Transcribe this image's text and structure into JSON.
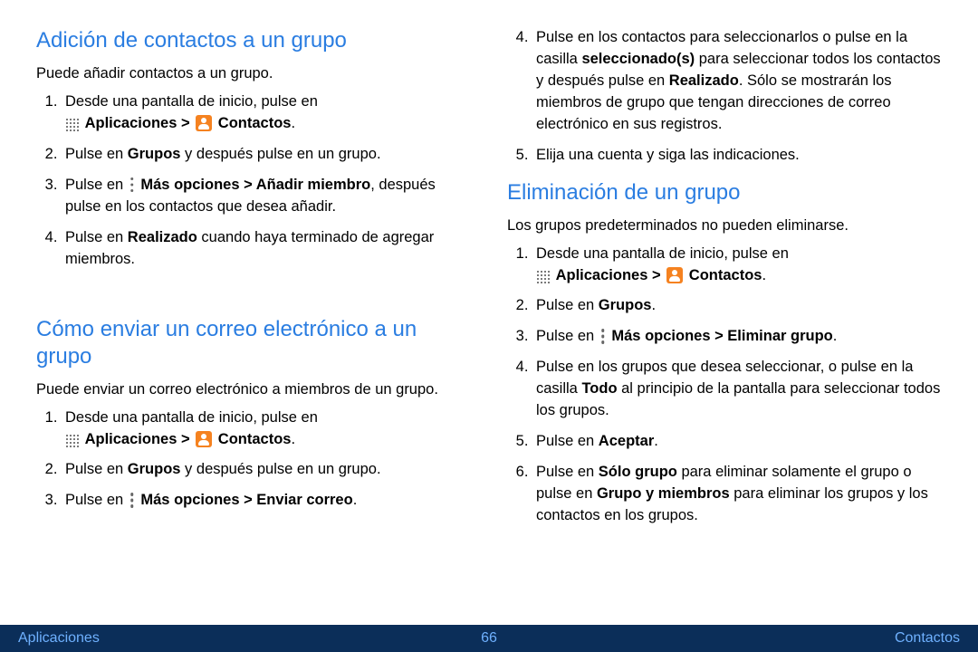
{
  "left": {
    "s1": {
      "title": "Adición de contactos a un grupo",
      "intro": "Puede añadir contactos a un grupo.",
      "li1": "Desde una pantalla de inicio, pulse en ",
      "apps": "Aplicaciones",
      "gt": " > ",
      "contacts": "Contactos",
      "period": ".",
      "li2a": "Pulse en ",
      "li2b": "Grupos",
      "li2c": " y después pulse en un grupo.",
      "li3a": "Pulse en ",
      "li3b": "Más opciones > Añadir miembro",
      "li3c": ", ",
      "li3d": "después pulse en los contactos que desea añadir.",
      "li4a": "Pulse en ",
      "li4b": "Realizado",
      "li4c": " cuando haya terminado de agregar miembros."
    },
    "s2": {
      "title": "Cómo enviar un correo electrónico a un grupo",
      "intro": "Puede enviar un correo electrónico a miembros de un grupo.",
      "li1": "Desde una pantalla de inicio, pulse en ",
      "apps": "Aplicaciones",
      "gt": " > ",
      "contacts": "Contactos",
      "period": ".",
      "li2a": "Pulse en ",
      "li2b": "Grupos",
      "li2c": " y después pulse en un grupo.",
      "li3a": "Pulse en ",
      "li3b": "Más opciones > Enviar correo",
      "li3c": "."
    }
  },
  "right": {
    "li4a": "Pulse en los contactos para seleccionarlos o pulse en la casilla ",
    "li4b": "seleccionado(s)",
    "li4c": " para seleccionar todos los contactos y después pulse en ",
    "li4d": "Realizado",
    "li4e": ". Sólo se mostrarán los miembros de grupo que tengan direcciones de correo electrónico en sus registros.",
    "li5": "Elija una cuenta y siga las indicaciones.",
    "s3": {
      "title": "Eliminación de un grupo",
      "intro": "Los grupos predeterminados no pueden eliminarse.",
      "li1": "Desde una pantalla de inicio, pulse en ",
      "apps": "Aplicaciones",
      "gt": " > ",
      "contacts": "Contactos",
      "period": ".",
      "li2a": "Pulse en ",
      "li2b": "Grupos",
      "li2c": ".",
      "li3a": "Pulse en ",
      "li3b": "Más opciones > Eliminar grupo",
      "li3c": ".",
      "li4a": "Pulse en los grupos que desea seleccionar, o pulse en la casilla ",
      "li4b": "Todo",
      "li4c": " al principio de la pantalla para seleccionar todos los grupos.",
      "li5a": "Pulse en ",
      "li5b": "Aceptar",
      "li5c": ".",
      "li6a": "Pulse en ",
      "li6b": "Sólo grupo",
      "li6c": " para eliminar solamente el grupo o pulse en ",
      "li6d": "Grupo y miembros",
      "li6e": " para eliminar los grupos y los contactos en los grupos."
    }
  },
  "footer": {
    "left": "Aplicaciones",
    "center": "66",
    "right": "Contactos"
  }
}
